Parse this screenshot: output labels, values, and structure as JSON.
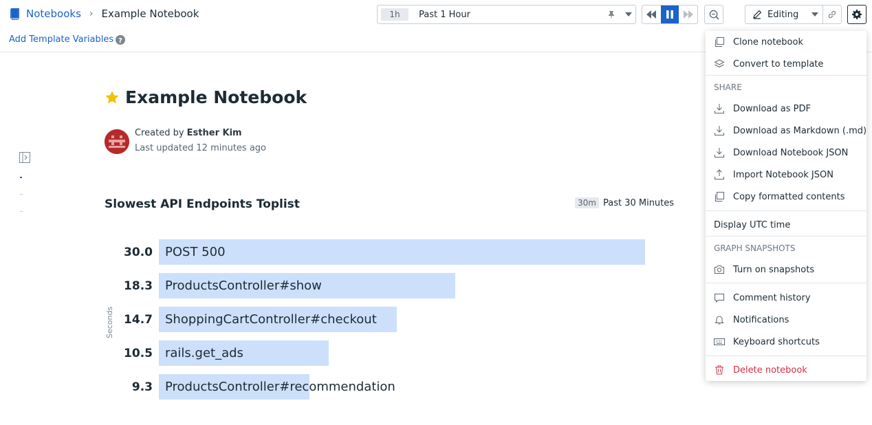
{
  "breadcrumb": {
    "root": "Notebooks",
    "separator": "›",
    "current": "Example Notebook"
  },
  "timepicker": {
    "badge": "1h",
    "label": "Past 1 Hour"
  },
  "editing": {
    "label": "Editing"
  },
  "subbar": {
    "add_vars": "Add Template Variables"
  },
  "notebook": {
    "title": "Example Notebook",
    "created_prefix": "Created by",
    "author": "Esther Kim",
    "updated": "Last updated 12 minutes ago"
  },
  "widget": {
    "title": "Slowest API Endpoints Toplist",
    "time_badge": "30m",
    "time_label": "Past 30 Minutes",
    "unit": "Seconds"
  },
  "chart_data": {
    "type": "bar",
    "title": "Slowest API Endpoints Toplist",
    "ylabel": "Seconds",
    "categories": [
      "POST 500",
      "ProductsController#show",
      "ShoppingCartController#checkout",
      "rails.get_ads",
      "ProductsController#recommendation"
    ],
    "values": [
      30.0,
      18.3,
      14.7,
      10.5,
      9.3
    ],
    "value_labels": [
      "30.0",
      "18.3",
      "14.7",
      "10.5",
      "9.3"
    ],
    "xlim": [
      0,
      30.0
    ],
    "bar_color": "#cce0fb"
  },
  "menu": {
    "clone": "Clone notebook",
    "convert": "Convert to template",
    "share_header": "SHARE",
    "download_pdf": "Download as PDF",
    "download_md": "Download as Markdown (.md)",
    "download_json": "Download Notebook JSON",
    "import_json": "Import Notebook JSON",
    "copy_formatted": "Copy formatted contents",
    "utc": "Display UTC time",
    "snapshots_header": "GRAPH SNAPSHOTS",
    "snapshots": "Turn on snapshots",
    "comments": "Comment history",
    "notifications": "Notifications",
    "shortcuts": "Keyboard shortcuts",
    "delete": "Delete notebook"
  },
  "colors": {
    "accent": "#1a63c9",
    "danger": "#d33043",
    "star": "#f2c100"
  }
}
